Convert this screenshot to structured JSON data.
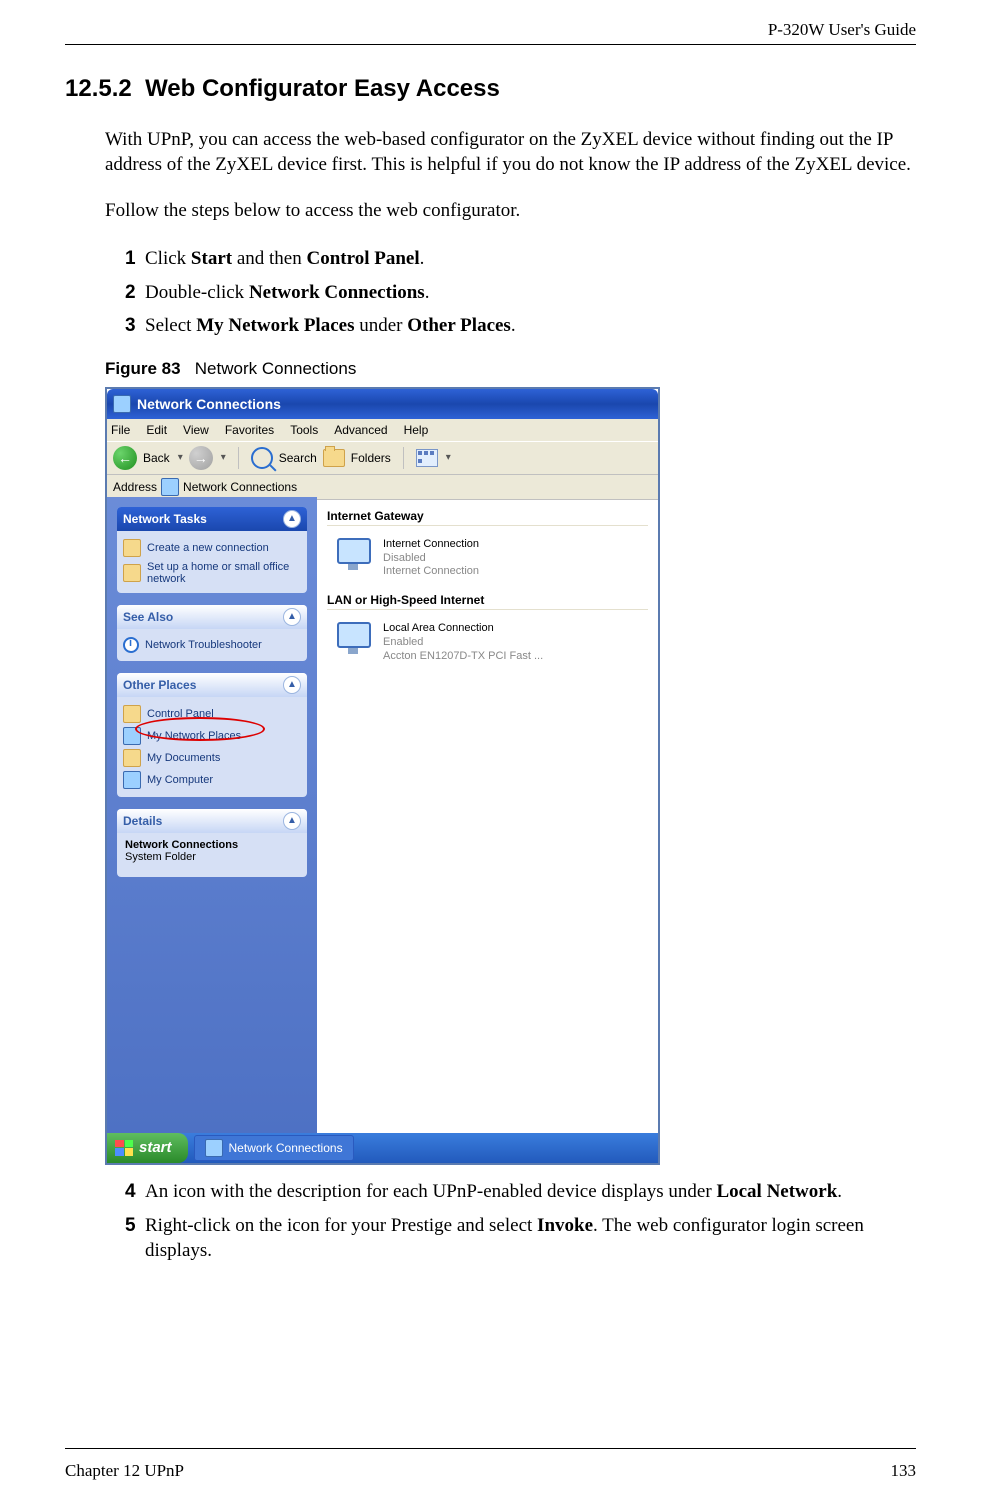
{
  "header": {
    "guide_name": "P-320W User's Guide"
  },
  "footer": {
    "chapter": "Chapter 12 UPnP",
    "page_number": "133"
  },
  "section": {
    "number": "12.5.2",
    "title": "Web Configurator Easy Access"
  },
  "paragraphs": {
    "intro": "With UPnP, you can access the web-based configurator on the ZyXEL device without finding out the IP address of the ZyXEL device first. This is helpful if you do not know the IP address of the ZyXEL device.",
    "follow": "Follow the steps below to access the web configurator."
  },
  "steps_top": [
    {
      "num": "1",
      "pre": "Click ",
      "bold1": "Start",
      "mid": " and then ",
      "bold2": "Control Panel",
      "post": "."
    },
    {
      "num": "2",
      "pre": "Double-click ",
      "bold1": "Network Connections",
      "mid": "",
      "bold2": "",
      "post": "."
    },
    {
      "num": "3",
      "pre": "Select ",
      "bold1": "My Network Places",
      "mid": " under ",
      "bold2": "Other Places",
      "post": "."
    }
  ],
  "steps_bottom": [
    {
      "num": "4",
      "pre": "An icon with the description for each UPnP-enabled device displays under ",
      "bold1": "Local Network",
      "post": "."
    },
    {
      "num": "5",
      "pre": "Right-click on the icon for your Prestige and select ",
      "bold1": "Invoke",
      "post": ". The web configurator login screen displays."
    }
  ],
  "figure": {
    "label": "Figure 83",
    "caption": "Network Connections"
  },
  "shot": {
    "window_title": "Network Connections",
    "menus": [
      "File",
      "Edit",
      "View",
      "Favorites",
      "Tools",
      "Advanced",
      "Help"
    ],
    "toolbar": {
      "back": "Back",
      "search": "Search",
      "folders": "Folders"
    },
    "addressbar": {
      "label": "Address",
      "value": "Network Connections"
    },
    "panels": {
      "network_tasks": {
        "title": "Network Tasks",
        "items": [
          "Create a new connection",
          "Set up a home or small office network"
        ]
      },
      "see_also": {
        "title": "See Also",
        "items": [
          "Network Troubleshooter"
        ]
      },
      "other_places": {
        "title": "Other Places",
        "items": [
          "Control Panel",
          "My Network Places",
          "My Documents",
          "My Computer"
        ]
      },
      "details": {
        "title": "Details",
        "line1": "Network Connections",
        "line2": "System Folder"
      }
    },
    "groups": {
      "internet_gateway": {
        "title": "Internet Gateway",
        "item_name": "Internet Connection",
        "item_status": "Disabled",
        "item_sub": "Internet Connection"
      },
      "lan": {
        "title": "LAN or High-Speed Internet",
        "item_name": "Local Area Connection",
        "item_status": "Enabled",
        "item_sub": "Accton EN1207D-TX PCI Fast ..."
      }
    },
    "taskbar": {
      "start": "start",
      "task": "Network Connections"
    }
  }
}
